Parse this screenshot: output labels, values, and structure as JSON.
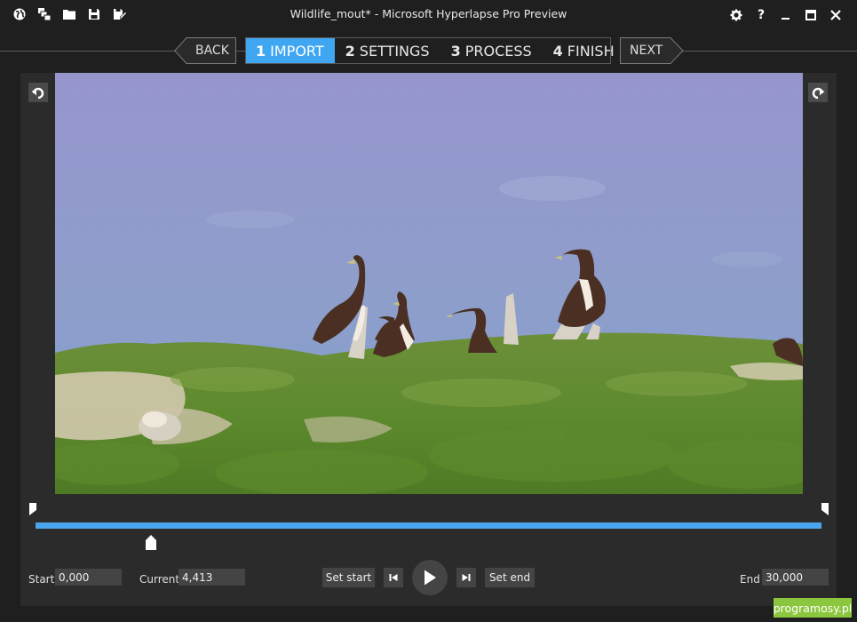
{
  "window": {
    "title": "Wildlife_mout* - Microsoft Hyperlapse Pro Preview",
    "toolbar_icons": [
      "globe-icon",
      "new-project-icon",
      "open-folder-icon",
      "save-icon",
      "save-as-icon"
    ],
    "controls": [
      "settings-icon",
      "help-icon",
      "minimize-icon",
      "maximize-icon",
      "close-icon"
    ],
    "help_label": "?"
  },
  "wizard": {
    "back_label": "BACK",
    "next_label": "NEXT",
    "steps": [
      {
        "number": "1",
        "label": "IMPORT",
        "active": true
      },
      {
        "number": "2",
        "label": "SETTINGS",
        "active": false
      },
      {
        "number": "3",
        "label": "PROCESS",
        "active": false
      },
      {
        "number": "4",
        "label": "FINISH",
        "active": false
      }
    ],
    "accent_color": "#3fa7f2"
  },
  "timeline": {
    "start_label": "Start",
    "start_value": "0,000",
    "current_label": "Current",
    "current_value": "4,413",
    "end_label": "End",
    "end_value": "30,000",
    "set_start_label": "Set start",
    "set_end_label": "Set end",
    "track_color": "#49a6ee"
  },
  "watermark": {
    "text": "programosy.pl",
    "color": "#8cc63f"
  }
}
